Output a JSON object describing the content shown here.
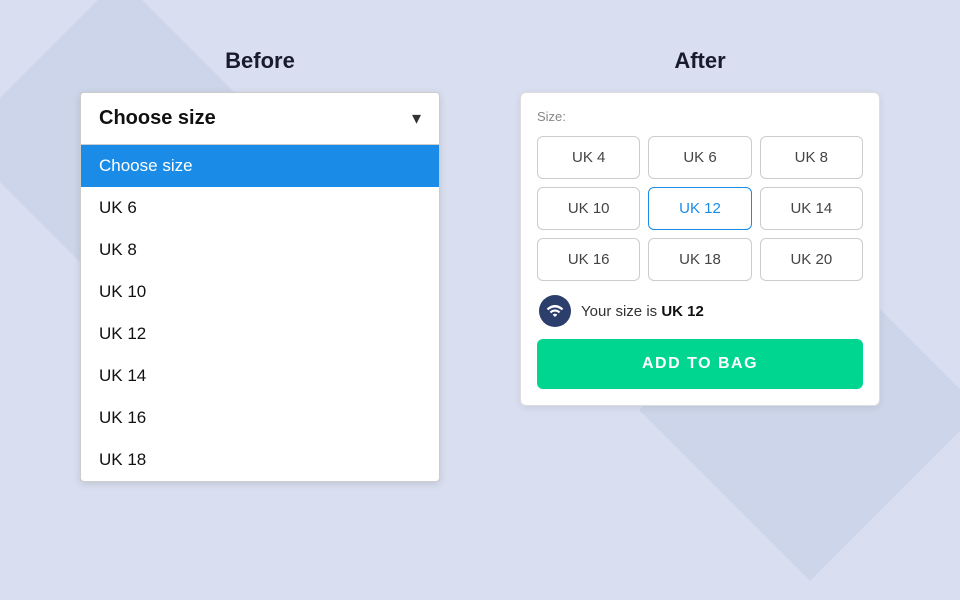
{
  "before": {
    "section_label": "Before",
    "dropdown": {
      "selected_label": "Choose size",
      "chevron": "▾",
      "options": [
        {
          "label": "Choose size",
          "selected": true
        },
        {
          "label": "UK 6",
          "selected": false
        },
        {
          "label": "UK 8",
          "selected": false
        },
        {
          "label": "UK 10",
          "selected": false
        },
        {
          "label": "UK 12",
          "selected": false
        },
        {
          "label": "UK 14",
          "selected": false
        },
        {
          "label": "UK 16",
          "selected": false
        },
        {
          "label": "UK 18",
          "selected": false
        }
      ]
    }
  },
  "after": {
    "section_label": "After",
    "size_label": "Size:",
    "sizes": [
      {
        "label": "UK 4",
        "active": false
      },
      {
        "label": "UK 6",
        "active": false
      },
      {
        "label": "UK 8",
        "active": false
      },
      {
        "label": "UK 10",
        "active": false
      },
      {
        "label": "UK 12",
        "active": true
      },
      {
        "label": "UK 14",
        "active": false
      },
      {
        "label": "UK 16",
        "active": false
      },
      {
        "label": "UK 18",
        "active": false
      },
      {
        "label": "UK 20",
        "active": false
      }
    ],
    "your_size_prefix": "Your size is ",
    "your_size_value": "UK 12",
    "add_to_bag_label": "ADD TO BAG"
  }
}
